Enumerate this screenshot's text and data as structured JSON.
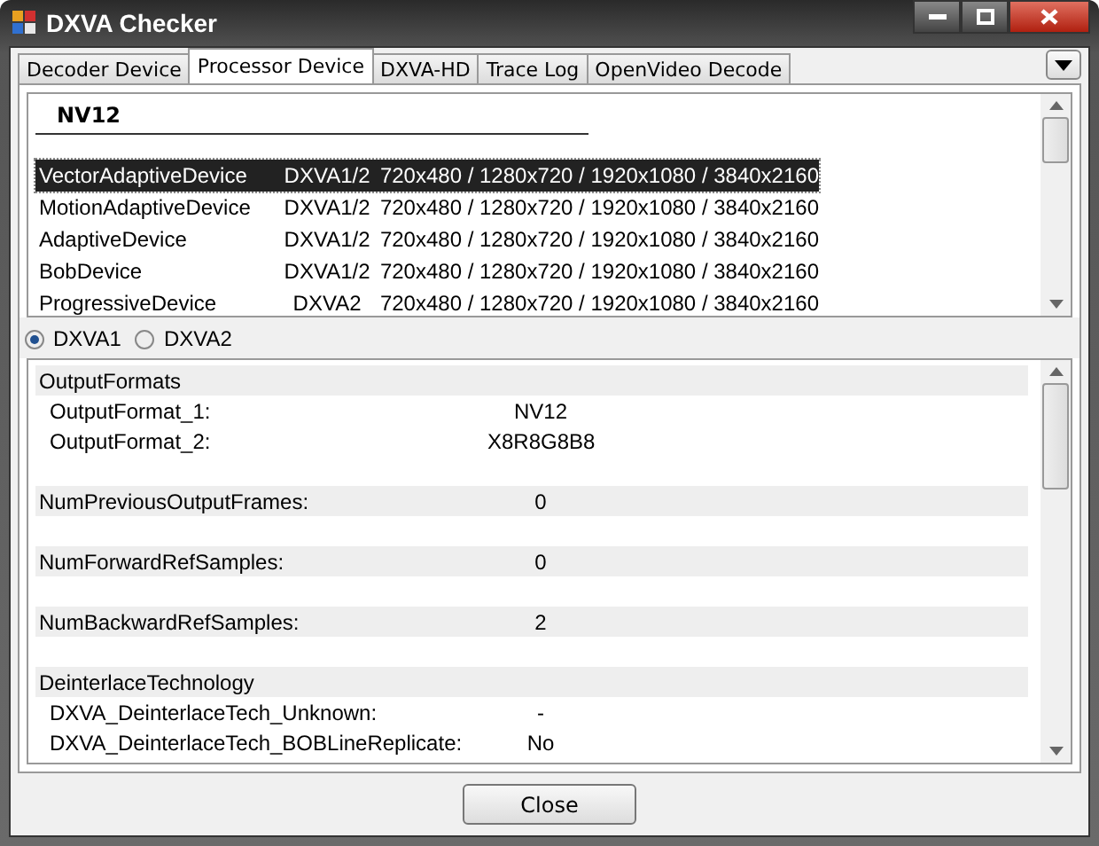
{
  "window": {
    "title": "DXVA Checker"
  },
  "tabs": [
    {
      "label": "Decoder Device",
      "selected": false
    },
    {
      "label": "Processor Device",
      "selected": true
    },
    {
      "label": "DXVA-HD",
      "selected": false
    },
    {
      "label": "Trace Log",
      "selected": false
    },
    {
      "label": "OpenVideo Decode",
      "selected": false
    }
  ],
  "devices": {
    "heading": "NV12",
    "rows": [
      {
        "name": "VectorAdaptiveDevice",
        "api": "DXVA1/2",
        "resolutions": "720x480 / 1280x720 / 1920x1080 / 3840x2160",
        "selected": true
      },
      {
        "name": "MotionAdaptiveDevice",
        "api": "DXVA1/2",
        "resolutions": "720x480 / 1280x720 / 1920x1080 / 3840x2160",
        "selected": false
      },
      {
        "name": "AdaptiveDevice",
        "api": "DXVA1/2",
        "resolutions": "720x480 / 1280x720 / 1920x1080 / 3840x2160",
        "selected": false
      },
      {
        "name": "BobDevice",
        "api": "DXVA1/2",
        "resolutions": "720x480 / 1280x720 / 1920x1080 / 3840x2160",
        "selected": false
      },
      {
        "name": "ProgressiveDevice",
        "api": "DXVA2",
        "resolutions": "720x480 / 1280x720 / 1920x1080 / 3840x2160",
        "selected": false
      }
    ]
  },
  "modes": [
    {
      "label": "DXVA1",
      "selected": true
    },
    {
      "label": "DXVA2",
      "selected": false
    }
  ],
  "properties": [
    {
      "kind": "group",
      "label": "OutputFormats"
    },
    {
      "kind": "sub",
      "label": "OutputFormat_1:",
      "value": "NV12"
    },
    {
      "kind": "sub",
      "label": "OutputFormat_2:",
      "value": "X8R8G8B8"
    },
    {
      "kind": "field",
      "label": "NumPreviousOutputFrames:",
      "value": "0"
    },
    {
      "kind": "field",
      "label": "NumForwardRefSamples:",
      "value": "0"
    },
    {
      "kind": "field",
      "label": "NumBackwardRefSamples:",
      "value": "2"
    },
    {
      "kind": "group",
      "label": "DeinterlaceTechnology"
    },
    {
      "kind": "sub",
      "label": "DXVA_DeinterlaceTech_Unknown:",
      "value": "-"
    },
    {
      "kind": "sub",
      "label": "DXVA_DeinterlaceTech_BOBLineReplicate:",
      "value": "No"
    }
  ],
  "close_button": "Close"
}
